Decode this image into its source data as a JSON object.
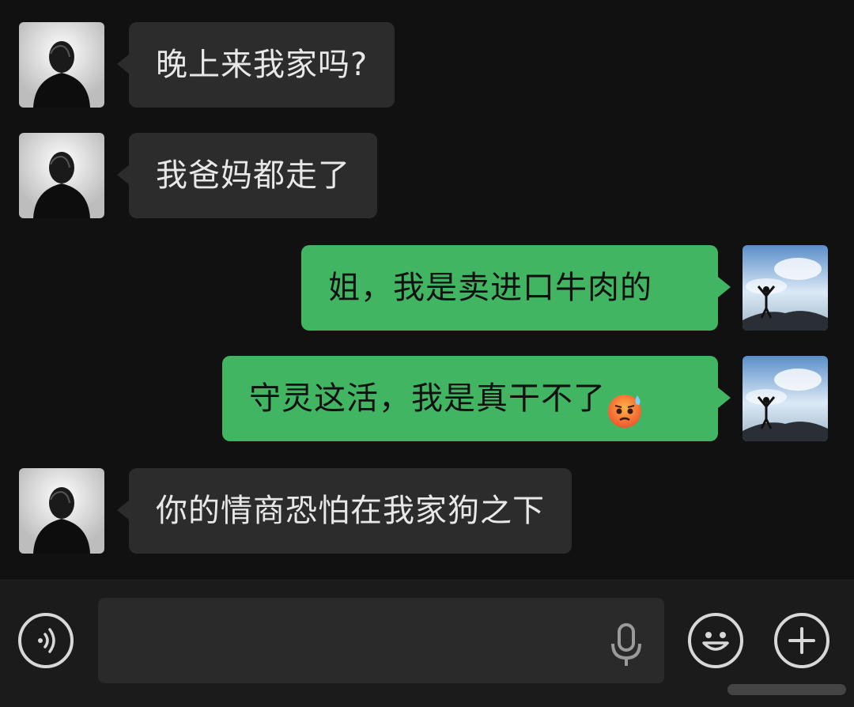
{
  "chat": {
    "messages": [
      {
        "sender": "other",
        "text": "晚上来我家吗?"
      },
      {
        "sender": "other",
        "text": "我爸妈都走了"
      },
      {
        "sender": "self",
        "text": "姐，我是卖进口牛肉的"
      },
      {
        "sender": "self",
        "text": "守灵这活，我是真干不了",
        "emoji": "anxious-sweat-emoji"
      },
      {
        "sender": "other",
        "text": "你的情商恐怕在我家狗之下"
      }
    ]
  },
  "input_bar": {
    "voice_icon": "voice-mode-icon",
    "mic_icon": "microphone-icon",
    "emoji_icon": "emoji-icon",
    "more_icon": "plus-icon",
    "input_value": ""
  },
  "colors": {
    "background": "#111111",
    "incoming_bubble": "#2c2c2c",
    "outgoing_bubble": "#42b563",
    "incoming_text": "#e8e8e8",
    "outgoing_text": "#101010"
  }
}
